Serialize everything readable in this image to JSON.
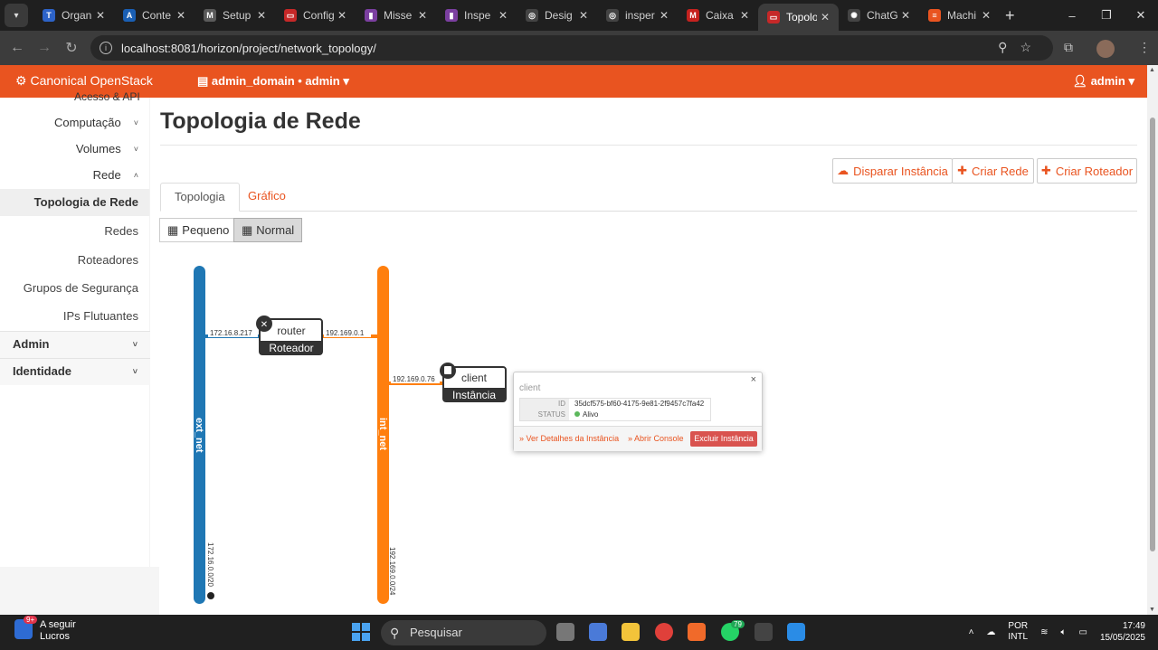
{
  "browser": {
    "tabs": [
      {
        "title": "Organi",
        "color": "#2d63c8",
        "glyph": "T"
      },
      {
        "title": "Conte",
        "color": "#1a5fb4",
        "glyph": "A"
      },
      {
        "title": "Setup",
        "color": "#5a5a5a",
        "glyph": "M"
      },
      {
        "title": "Config",
        "color": "#c62828",
        "glyph": "▭"
      },
      {
        "title": "Misse",
        "color": "#7b3fa0",
        "glyph": "▮"
      },
      {
        "title": "Inspe",
        "color": "#7b3fa0",
        "glyph": "▮"
      },
      {
        "title": "Desig",
        "color": "#444444",
        "glyph": "◎"
      },
      {
        "title": "insper",
        "color": "#444444",
        "glyph": "◎"
      },
      {
        "title": "Caixa",
        "color": "#c5221f",
        "glyph": "M"
      },
      {
        "title": "Topolo",
        "color": "#c62828",
        "glyph": "▭"
      },
      {
        "title": "ChatG",
        "color": "#444444",
        "glyph": "✺"
      },
      {
        "title": "Machi",
        "color": "#e95420",
        "glyph": "≡"
      }
    ],
    "url": "localhost:8081/horizon/project/network_topology/"
  },
  "header": {
    "brand": "Canonical OpenStack",
    "project": "admin_domain • admin ▾",
    "user": "admin ▾"
  },
  "sidebar": {
    "clipped": "Acesso & API",
    "items": [
      {
        "label": "Computação",
        "chev": "˅"
      },
      {
        "label": "Volumes",
        "chev": "˅"
      },
      {
        "label": "Rede",
        "chev": "˄"
      }
    ],
    "subitems": [
      "Topologia de Rede",
      "Redes",
      "Roteadores",
      "Grupos de Segurança",
      "IPs Flutuantes"
    ],
    "sections": [
      "Admin",
      "Identidade"
    ]
  },
  "page": {
    "title": "Topologia de Rede",
    "buttons": {
      "launch": "Disparar Instância",
      "create_net": "Criar Rede",
      "create_router": "Criar Roteador"
    },
    "tabs": {
      "topology": "Topologia",
      "graph": "Gráfico"
    },
    "size": {
      "small": "Pequeno",
      "normal": "Normal"
    }
  },
  "topology": {
    "ext_net": {
      "name": "ext_net",
      "cidr": "172.16.0.0/20",
      "color": "#1f77b4"
    },
    "int_net": {
      "name": "int_net",
      "cidr": "192.169.0.0/24",
      "color": "#ff7f0e"
    },
    "router": {
      "name": "router",
      "type": "Roteador",
      "ip_ext": "172.16.8.217",
      "ip_int": "192.169.0.1"
    },
    "instance": {
      "name": "client",
      "type": "Instância",
      "ip": "192.169.0.76"
    }
  },
  "popup": {
    "title": "client",
    "id_label": "ID",
    "id_value": "35dcf575-bf60-4175-9e81-2f9457c7fa42",
    "status_label": "STATUS",
    "status_value": "Alivo",
    "link_details": "» Ver Detalhes da Instância",
    "link_console": "» Abrir Console",
    "delete": "Excluir Instância",
    "close": "×"
  },
  "taskbar": {
    "weather_badge": "9+",
    "weather_line1": "A seguir",
    "weather_line2": "Lucros",
    "search": "Pesquisar",
    "whatsapp_badge": "79",
    "lang1": "POR",
    "lang2": "INTL",
    "time": "17:49",
    "date": "15/05/2025"
  }
}
